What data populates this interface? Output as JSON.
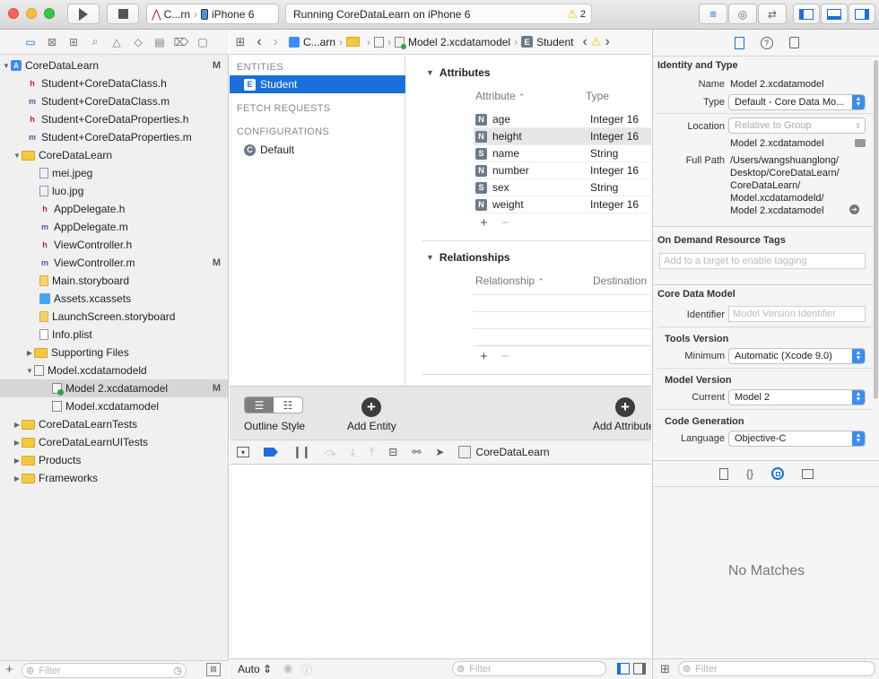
{
  "toolbar": {
    "scheme_project": "C...rn",
    "scheme_device": "iPhone 6",
    "status_text": "Running CoreDataLearn on iPhone 6",
    "warning_count": "2"
  },
  "navigator": {
    "items": [
      {
        "label": "CoreDataLearn",
        "badge": "M"
      },
      {
        "label": "Student+CoreDataClass.h",
        "badge": ""
      },
      {
        "label": "Student+CoreDataClass.m",
        "badge": ""
      },
      {
        "label": "Student+CoreDataProperties.h",
        "badge": ""
      },
      {
        "label": "Student+CoreDataProperties.m",
        "badge": ""
      },
      {
        "label": "CoreDataLearn",
        "badge": ""
      },
      {
        "label": "mei.jpeg",
        "badge": ""
      },
      {
        "label": "luo.jpg",
        "badge": ""
      },
      {
        "label": "AppDelegate.h",
        "badge": ""
      },
      {
        "label": "AppDelegate.m",
        "badge": ""
      },
      {
        "label": "ViewController.h",
        "badge": ""
      },
      {
        "label": "ViewController.m",
        "badge": "M"
      },
      {
        "label": "Main.storyboard",
        "badge": ""
      },
      {
        "label": "Assets.xcassets",
        "badge": ""
      },
      {
        "label": "LaunchScreen.storyboard",
        "badge": ""
      },
      {
        "label": "Info.plist",
        "badge": ""
      },
      {
        "label": "Supporting Files",
        "badge": ""
      },
      {
        "label": "Model.xcdatamodeld",
        "badge": ""
      },
      {
        "label": "Model 2.xcdatamodel",
        "badge": "M"
      },
      {
        "label": "Model.xcdatamodel",
        "badge": ""
      },
      {
        "label": "CoreDataLearnTests",
        "badge": ""
      },
      {
        "label": "CoreDataLearnUITests",
        "badge": ""
      },
      {
        "label": "Products",
        "badge": ""
      },
      {
        "label": "Frameworks",
        "badge": ""
      }
    ],
    "filter_placeholder": "Filter"
  },
  "jumpbar": {
    "crumb1": "C...arn",
    "crumb2": "Model 2.xcdatamodel",
    "crumb3": "Student"
  },
  "entities": {
    "entities_header": "ENTITIES",
    "entity": "Student",
    "fetch_header": "FETCH REQUESTS",
    "config_header": "CONFIGURATIONS",
    "config": "Default"
  },
  "attributes": {
    "title": "Attributes",
    "col_attr": "Attribute",
    "col_type": "Type",
    "rows": [
      {
        "badge": "N",
        "name": "age",
        "type": "Integer 16"
      },
      {
        "badge": "N",
        "name": "height",
        "type": "Integer 16"
      },
      {
        "badge": "S",
        "name": "name",
        "type": "String"
      },
      {
        "badge": "N",
        "name": "number",
        "type": "Integer 16"
      },
      {
        "badge": "S",
        "name": "sex",
        "type": "String"
      },
      {
        "badge": "N",
        "name": "weight",
        "type": "Integer 16"
      }
    ]
  },
  "relationships": {
    "title": "Relationships",
    "col_rel": "Relationship",
    "col_dest": "Destination"
  },
  "editor_bar": {
    "outline_style": "Outline Style",
    "add_entity": "Add Entity",
    "add_attribute": "Add Attribute"
  },
  "debug": {
    "target": "CoreDataLearn",
    "auto": "Auto",
    "filter_placeholder": "Filter"
  },
  "inspector": {
    "identity_header": "Identity and Type",
    "name_label": "Name",
    "name_value": "Model 2.xcdatamodel",
    "type_label": "Type",
    "type_value": "Default - Core Data Mo...",
    "location_label": "Location",
    "location_value": "Relative to Group",
    "location_file": "Model 2.xcdatamodel",
    "fullpath_label": "Full Path",
    "fullpath_lines": [
      "/Users/wangshuanglong/",
      "Desktop/CoreDataLearn/",
      "CoreDataLearn/",
      "Model.xcdatamodeld/",
      "Model 2.xcdatamodel"
    ],
    "odr_header": "On Demand Resource Tags",
    "odr_placeholder": "Add to a target to enable tagging",
    "cdm_header": "Core Data Model",
    "identifier_label": "Identifier",
    "identifier_placeholder": "Model Version Identifier",
    "tools_header": "Tools Version",
    "minimum_label": "Minimum",
    "minimum_value": "Automatic (Xcode 9.0)",
    "model_version_header": "Model Version",
    "current_label": "Current",
    "current_value": "Model 2",
    "codegen_header": "Code Generation",
    "language_label": "Language",
    "language_value": "Objective-C",
    "no_matches": "No Matches",
    "filter_placeholder": "Filter"
  },
  "colors": {
    "selection_blue": "#1a6fdc",
    "warning_yellow": "#f2c200",
    "popup_blue": "#3b8cf4"
  }
}
